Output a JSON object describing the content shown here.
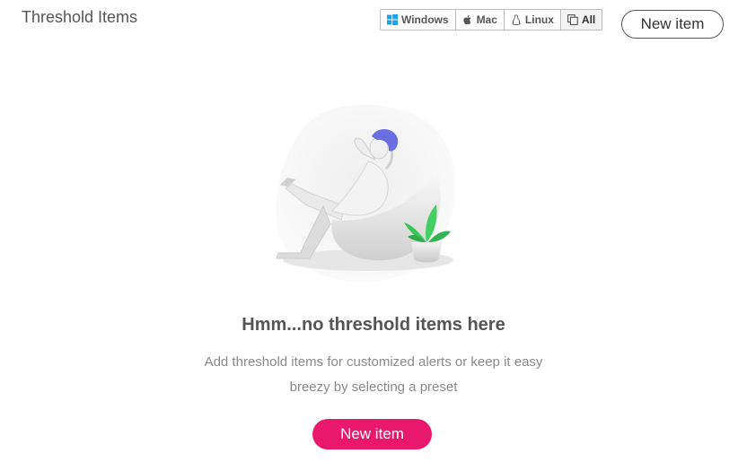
{
  "header": {
    "title": "Threshold Items",
    "new_item_label": "New item"
  },
  "os_filter": {
    "options": [
      {
        "label": "Windows",
        "icon": "windows-icon",
        "color": "#1aa1f0"
      },
      {
        "label": "Mac",
        "icon": "apple-icon"
      },
      {
        "label": "Linux",
        "icon": "linux-icon"
      },
      {
        "label": "All",
        "icon": "copy-icon",
        "selected": true
      }
    ]
  },
  "empty_state": {
    "illustration": "person-relaxing-in-chair-illustration",
    "title": "Hmm...no threshold items here",
    "description": "Add threshold items for customized alerts or keep it easy breezy by selecting a preset",
    "button_label": "New item"
  },
  "colors": {
    "accent": "#e8196c",
    "hair": "#6b6de3",
    "plant": "#3cc45a"
  }
}
